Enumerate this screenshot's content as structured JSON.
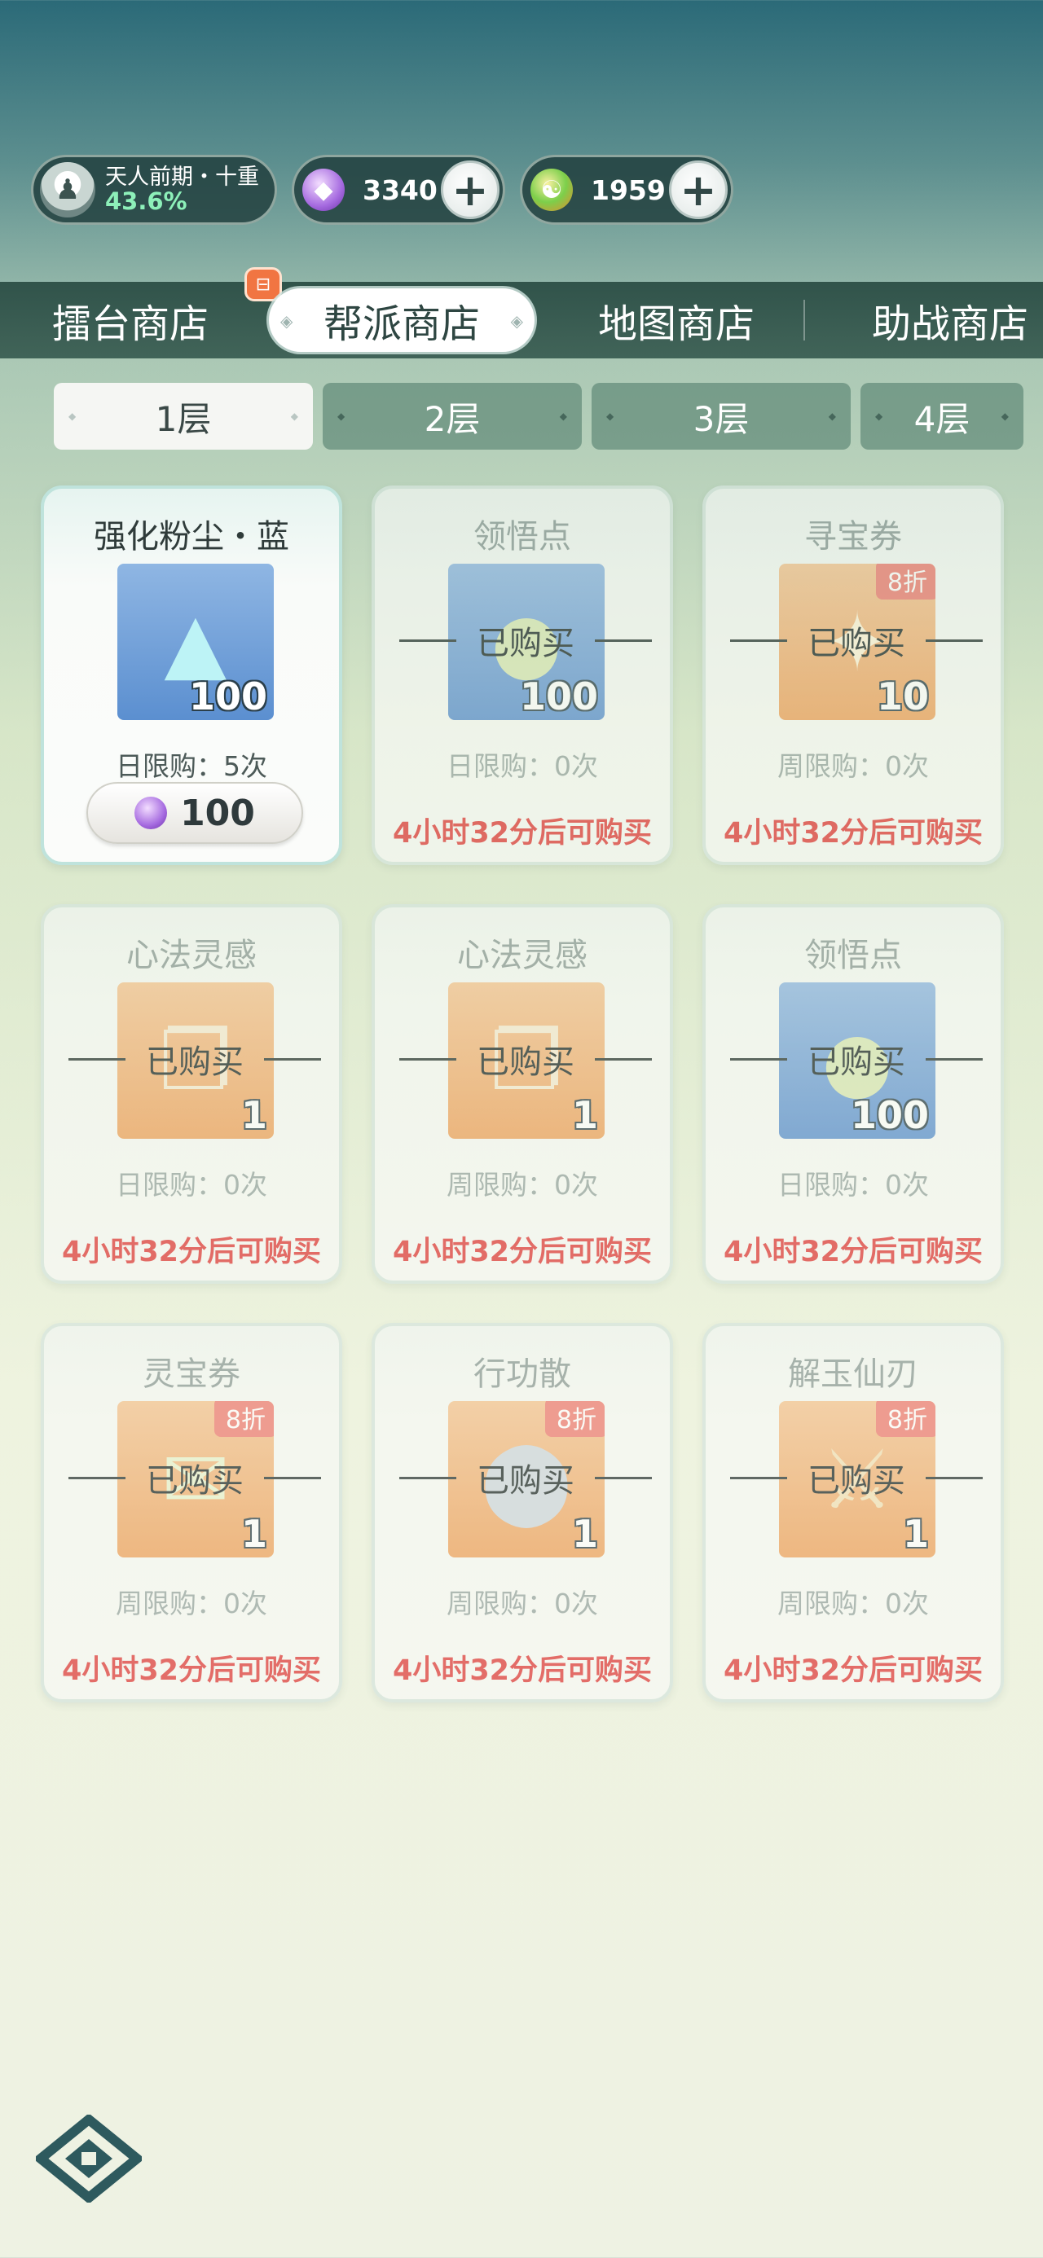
{
  "status": {
    "realm_name": "天人前期・十重",
    "realm_progress": "43.6%",
    "currencies": [
      {
        "icon": "purple-gem-icon",
        "value": "3340"
      },
      {
        "icon": "gold-coin-icon",
        "value": "1959"
      }
    ]
  },
  "shop_tabs": [
    {
      "label": "擂台商店",
      "active": false
    },
    {
      "label": "帮派商店",
      "active": true
    },
    {
      "label": "地图商店",
      "active": false
    },
    {
      "label": "助战商店",
      "active": false
    }
  ],
  "floor_tabs": [
    {
      "label": "1层",
      "active": true
    },
    {
      "label": "2层",
      "active": false
    },
    {
      "label": "3层",
      "active": false
    },
    {
      "label": "4层",
      "active": false
    }
  ],
  "items": [
    {
      "name": "强化粉尘・蓝",
      "quantity": "100",
      "limit": "日限购：5次",
      "price": "100",
      "sold": false,
      "bg": "blue",
      "icon": "crystal-dust-icon"
    },
    {
      "name": "领悟点",
      "quantity": "100",
      "limit": "日限购：0次",
      "sold_label": "已购买",
      "restock": "4小时32分后可购买",
      "sold": true,
      "bg": "blue",
      "icon": "insight-drop-icon"
    },
    {
      "name": "寻宝券",
      "quantity": "10",
      "limit": "周限购：0次",
      "discount": "8折",
      "sold_label": "已购买",
      "restock": "4小时32分后可购买",
      "sold": true,
      "bg": "orange",
      "icon": "treasure-ticket-icon"
    },
    {
      "name": "心法灵感",
      "quantity": "1",
      "limit": "日限购：0次",
      "sold_label": "已购买",
      "restock": "4小时32分后可购买",
      "sold": true,
      "bg": "orange",
      "icon": "scroll-icon"
    },
    {
      "name": "心法灵感",
      "quantity": "1",
      "limit": "周限购：0次",
      "sold_label": "已购买",
      "restock": "4小时32分后可购买",
      "sold": true,
      "bg": "orange",
      "icon": "scroll-icon"
    },
    {
      "name": "领悟点",
      "quantity": "100",
      "limit": "日限购：0次",
      "sold_label": "已购买",
      "restock": "4小时32分后可购买",
      "sold": true,
      "bg": "blue",
      "icon": "insight-drop-icon"
    },
    {
      "name": "灵宝券",
      "quantity": "1",
      "limit": "周限购：0次",
      "discount": "8折",
      "sold_label": "已购买",
      "restock": "4小时32分后可购买",
      "sold": true,
      "bg": "orange",
      "icon": "spirit-ticket-icon"
    },
    {
      "name": "行功散",
      "quantity": "1",
      "limit": "周限购：0次",
      "discount": "8折",
      "sold_label": "已购买",
      "restock": "4小时32分后可购买",
      "sold": true,
      "bg": "orange",
      "icon": "pill-icon"
    },
    {
      "name": "解玉仙刃",
      "quantity": "1",
      "limit": "周限购：0次",
      "discount": "8折",
      "sold_label": "已购买",
      "restock": "4小时32分后可购买",
      "sold": true,
      "bg": "orange",
      "icon": "blade-icon"
    }
  ]
}
